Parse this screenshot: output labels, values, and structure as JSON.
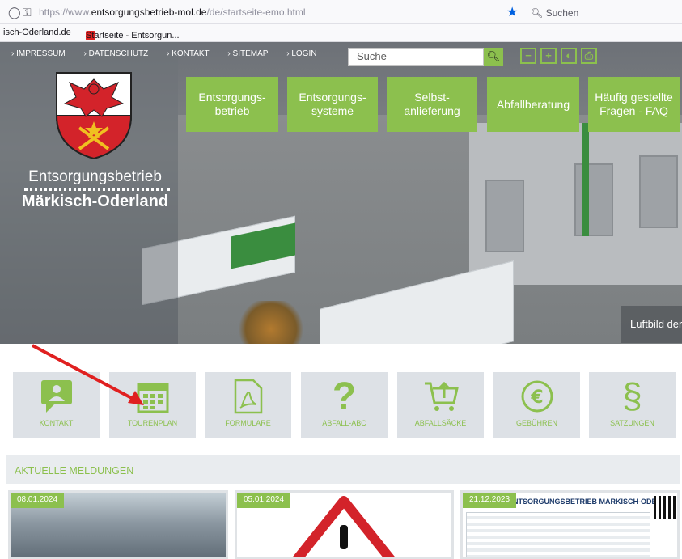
{
  "browser": {
    "url_prefix": "https://www.",
    "url_domain": "entsorgungsbetrieb-mol.de",
    "url_path": "/de/startseite-emo.html",
    "search_placeholder": "Suchen",
    "bookmarks": [
      "isch-Oderland.de",
      "Startseite - Entsorgun..."
    ]
  },
  "topnav": {
    "links": [
      "IMPRESSUM",
      "DATENSCHUTZ",
      "KONTAKT",
      "SITEMAP",
      "LOGIN"
    ],
    "search_placeholder": "Suche"
  },
  "logo": {
    "line1": "Entsorgungsbetrieb",
    "line2": "Märkisch-Oderland"
  },
  "mainnav": [
    "Entsorgungs- betrieb",
    "Entsorgungs- systeme",
    "Selbst- anlieferung",
    "Abfallberatung",
    "Häufig gestellte Fragen - FAQ"
  ],
  "hero_caption": "Luftbild der",
  "quicklinks": [
    {
      "label": "KONTAKT",
      "icon": "chat-bubble-icon"
    },
    {
      "label": "TOURENPLAN",
      "icon": "calendar-icon"
    },
    {
      "label": "FORMULARE",
      "icon": "pdf-document-icon"
    },
    {
      "label": "ABFALL-ABC",
      "icon": "question-mark-icon"
    },
    {
      "label": "ABFALLSÄCKE",
      "icon": "cart-icon"
    },
    {
      "label": "GEBÜHREN",
      "icon": "euro-icon"
    },
    {
      "label": "SATZUNGEN",
      "icon": "paragraph-icon"
    }
  ],
  "news": {
    "heading": "AKTUELLE MELDUNGEN",
    "items": [
      {
        "date": "08.01.2024"
      },
      {
        "date": "05.01.2024"
      },
      {
        "date": "21.12.2023",
        "image_title": "ENTSORGUNGSBETRIEB MÄRKISCH-ODERLAND"
      }
    ]
  },
  "colors": {
    "accent_green": "#8cc04e",
    "annotation_red": "#e02020"
  }
}
